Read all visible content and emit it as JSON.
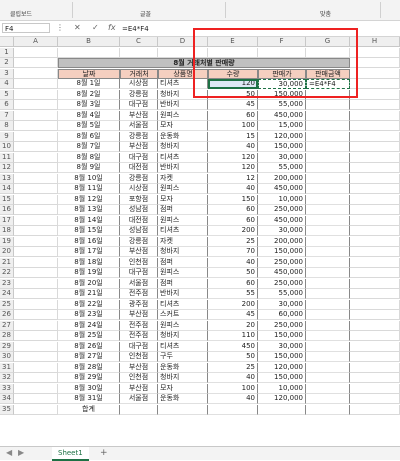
{
  "ribbon": {
    "groups": [
      "클립보드",
      "글꼴",
      "맞춤"
    ]
  },
  "formula_bar": {
    "name_box": "F4",
    "formula": "=E4*F4"
  },
  "columns": [
    "A",
    "B",
    "C",
    "D",
    "E",
    "F",
    "G",
    "H"
  ],
  "sheet": {
    "title": "8월 거래처별 판매량",
    "headers": [
      "날짜",
      "거래처",
      "상품명",
      "수량",
      "판매가",
      "판매금액"
    ],
    "rows": [
      [
        "8월 1일",
        "시상점",
        "티셔츠",
        "120",
        "30,000"
      ],
      [
        "8월 2일",
        "강릉점",
        "청바지",
        "50",
        "150,000"
      ],
      [
        "8월 3일",
        "대구점",
        "반바지",
        "45",
        "55,000"
      ],
      [
        "8월 4일",
        "부산점",
        "원피스",
        "60",
        "450,000"
      ],
      [
        "8월 5일",
        "서울점",
        "모자",
        "100",
        "15,000"
      ],
      [
        "8월 6일",
        "강릉점",
        "운동화",
        "15",
        "120,000"
      ],
      [
        "8월 7일",
        "부산점",
        "청바지",
        "40",
        "150,000"
      ],
      [
        "8월 8일",
        "대구점",
        "티셔츠",
        "120",
        "30,000"
      ],
      [
        "8월 9일",
        "대전점",
        "반바지",
        "120",
        "55,000"
      ],
      [
        "8월 10일",
        "강릉점",
        "자켓",
        "12",
        "200,000"
      ],
      [
        "8월 11일",
        "시상점",
        "원피스",
        "40",
        "450,000"
      ],
      [
        "8월 12일",
        "포항점",
        "모자",
        "150",
        "10,000"
      ],
      [
        "8월 13일",
        "성남점",
        "점퍼",
        "60",
        "250,000"
      ],
      [
        "8월 14일",
        "대전점",
        "원피스",
        "60",
        "450,000"
      ],
      [
        "8월 15일",
        "성남점",
        "티셔츠",
        "200",
        "30,000"
      ],
      [
        "8월 16일",
        "강릉점",
        "자켓",
        "25",
        "200,000"
      ],
      [
        "8월 17일",
        "부산점",
        "청바지",
        "70",
        "150,000"
      ],
      [
        "8월 18일",
        "인천점",
        "점퍼",
        "40",
        "250,000"
      ],
      [
        "8월 19일",
        "대구점",
        "원피스",
        "50",
        "450,000"
      ],
      [
        "8월 20일",
        "서울점",
        "점퍼",
        "60",
        "250,000"
      ],
      [
        "8월 21일",
        "전주점",
        "반바지",
        "55",
        "55,000"
      ],
      [
        "8월 22일",
        "광주점",
        "티셔츠",
        "200",
        "30,000"
      ],
      [
        "8월 23일",
        "부산점",
        "스커트",
        "45",
        "60,000"
      ],
      [
        "8월 24일",
        "전주점",
        "원피스",
        "20",
        "250,000"
      ],
      [
        "8월 25일",
        "전주점",
        "청바지",
        "110",
        "150,000"
      ],
      [
        "8월 26일",
        "대구점",
        "티셔츠",
        "450",
        "30,000"
      ],
      [
        "8월 27일",
        "인천점",
        "구두",
        "50",
        "150,000"
      ],
      [
        "8월 28일",
        "부산점",
        "운동화",
        "25",
        "120,000"
      ],
      [
        "8월 29일",
        "인천점",
        "청바지",
        "40",
        "150,000"
      ],
      [
        "8월 30일",
        "부산점",
        "모자",
        "100",
        "10,000"
      ],
      [
        "8월 31일",
        "서울점",
        "운동화",
        "40",
        "120,000"
      ]
    ],
    "total_label": "합계",
    "g4_value": "=E4*F4"
  },
  "tabs": {
    "sheet_name": "Sheet1",
    "add": "+"
  }
}
